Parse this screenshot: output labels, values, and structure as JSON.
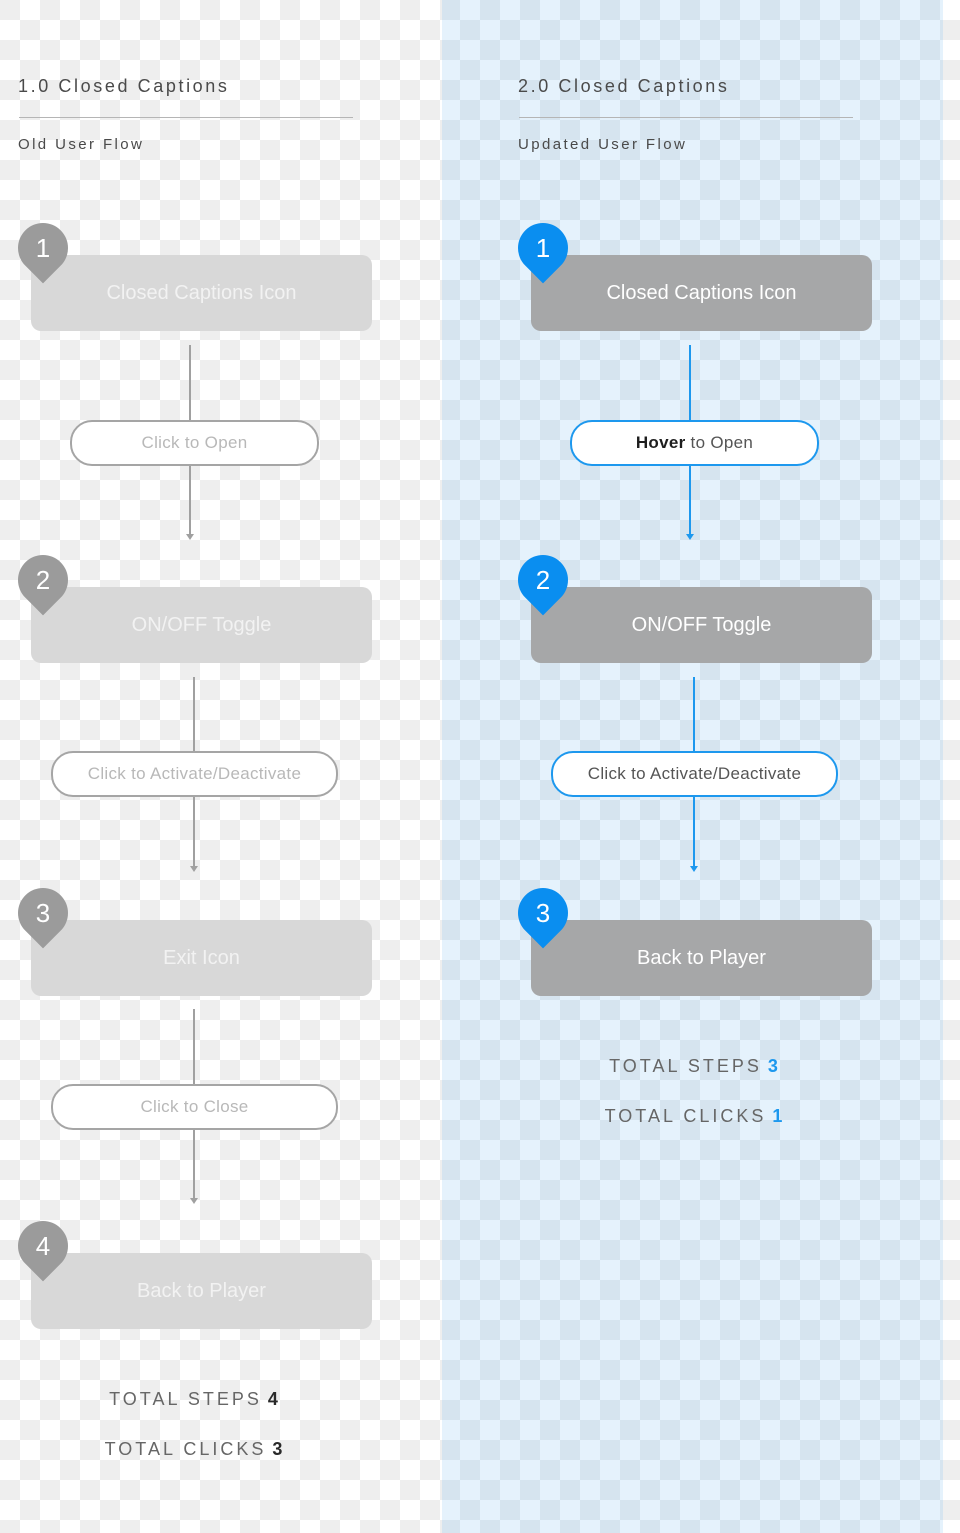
{
  "colors": {
    "accent_blue": "#0a8ef0",
    "old_box": "#d8d8d8",
    "new_box": "#a6a7a8",
    "old_pin": "#9b9b9b"
  },
  "old_flow": {
    "title": "1.0 Closed Captions",
    "subtitle": "Old User Flow",
    "steps": [
      {
        "number": "1",
        "label": "Closed Captions Icon"
      },
      {
        "number": "2",
        "label": "ON/OFF Toggle"
      },
      {
        "number": "3",
        "label": "Exit Icon"
      },
      {
        "number": "4",
        "label": "Back to Player"
      }
    ],
    "actions": [
      {
        "emphasis": "",
        "text": "Click to Open"
      },
      {
        "emphasis": "",
        "text": "Click to Activate/Deactivate"
      },
      {
        "emphasis": "",
        "text": "Click to Close"
      }
    ],
    "totals": {
      "steps_label": "TOTAL STEPS",
      "steps_value": "4",
      "clicks_label": "TOTAL CLICKS",
      "clicks_value": "3"
    }
  },
  "new_flow": {
    "title": "2.0 Closed Captions",
    "subtitle": "Updated User Flow",
    "steps": [
      {
        "number": "1",
        "label": "Closed Captions Icon"
      },
      {
        "number": "2",
        "label": "ON/OFF Toggle"
      },
      {
        "number": "3",
        "label": "Back to Player"
      }
    ],
    "actions": [
      {
        "emphasis": "Hover",
        "text": "to Open"
      },
      {
        "emphasis": "",
        "text": "Click to Activate/Deactivate"
      }
    ],
    "totals": {
      "steps_label": "TOTAL STEPS",
      "steps_value": "3",
      "clicks_label": "TOTAL CLICKS",
      "clicks_value": "1"
    }
  }
}
